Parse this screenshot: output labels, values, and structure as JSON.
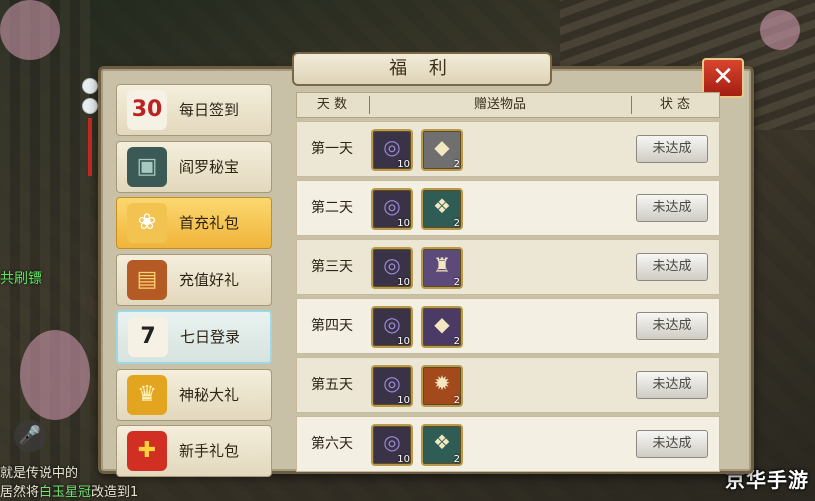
{
  "panel": {
    "title": "福 利",
    "close_label": "✕"
  },
  "menu": [
    {
      "label": "每日签到",
      "icon": "calendar-30-icon",
      "glyph": "30",
      "state": "normal"
    },
    {
      "label": "阎罗秘宝",
      "icon": "treasure-chest-dark-icon",
      "glyph": "▣",
      "state": "normal"
    },
    {
      "label": "首充礼包",
      "icon": "gift-bag-icon",
      "glyph": "❀",
      "state": "active"
    },
    {
      "label": "充值好礼",
      "icon": "treasure-chest-icon",
      "glyph": "▤",
      "state": "normal"
    },
    {
      "label": "七日登录",
      "icon": "calendar-7-icon",
      "glyph": "7",
      "state": "selected"
    },
    {
      "label": "神秘大礼",
      "icon": "golden-chest-icon",
      "glyph": "♛",
      "state": "normal"
    },
    {
      "label": "新手礼包",
      "icon": "red-gift-box-icon",
      "glyph": "✚",
      "state": "normal"
    }
  ],
  "table": {
    "headers": {
      "day": "天 数",
      "items": "赠送物品",
      "status": "状 态"
    },
    "rows": [
      {
        "day": "第一天",
        "item1_count": "10",
        "item2_count": "2",
        "item2_icon": "white-beast-icon",
        "status": "未达成"
      },
      {
        "day": "第二天",
        "item1_count": "10",
        "item2_count": "2",
        "item2_icon": "green-dragon-icon",
        "status": "未达成"
      },
      {
        "day": "第三天",
        "item1_count": "10",
        "item2_count": "2",
        "item2_icon": "warrior-portrait-icon",
        "status": "未达成"
      },
      {
        "day": "第四天",
        "item1_count": "10",
        "item2_count": "2",
        "item2_icon": "purple-beast-icon",
        "status": "未达成"
      },
      {
        "day": "第五天",
        "item1_count": "10",
        "item2_count": "2",
        "item2_icon": "fire-phoenix-icon",
        "status": "未达成"
      },
      {
        "day": "第六天",
        "item1_count": "10",
        "item2_count": "2",
        "item2_icon": "green-dragon-icon",
        "status": "未达成"
      }
    ]
  },
  "chat": {
    "tag": "共刷镖",
    "line1": "就是传说中的",
    "line2_prefix": "居然将",
    "line2_highlight": "白玉星冠",
    "line2_suffix": "改造到1"
  },
  "watermark": "京华手游",
  "colors": {
    "active_menu": "#f0b43a",
    "close_button": "#c23220",
    "chat_highlight": "#6fe46f"
  }
}
